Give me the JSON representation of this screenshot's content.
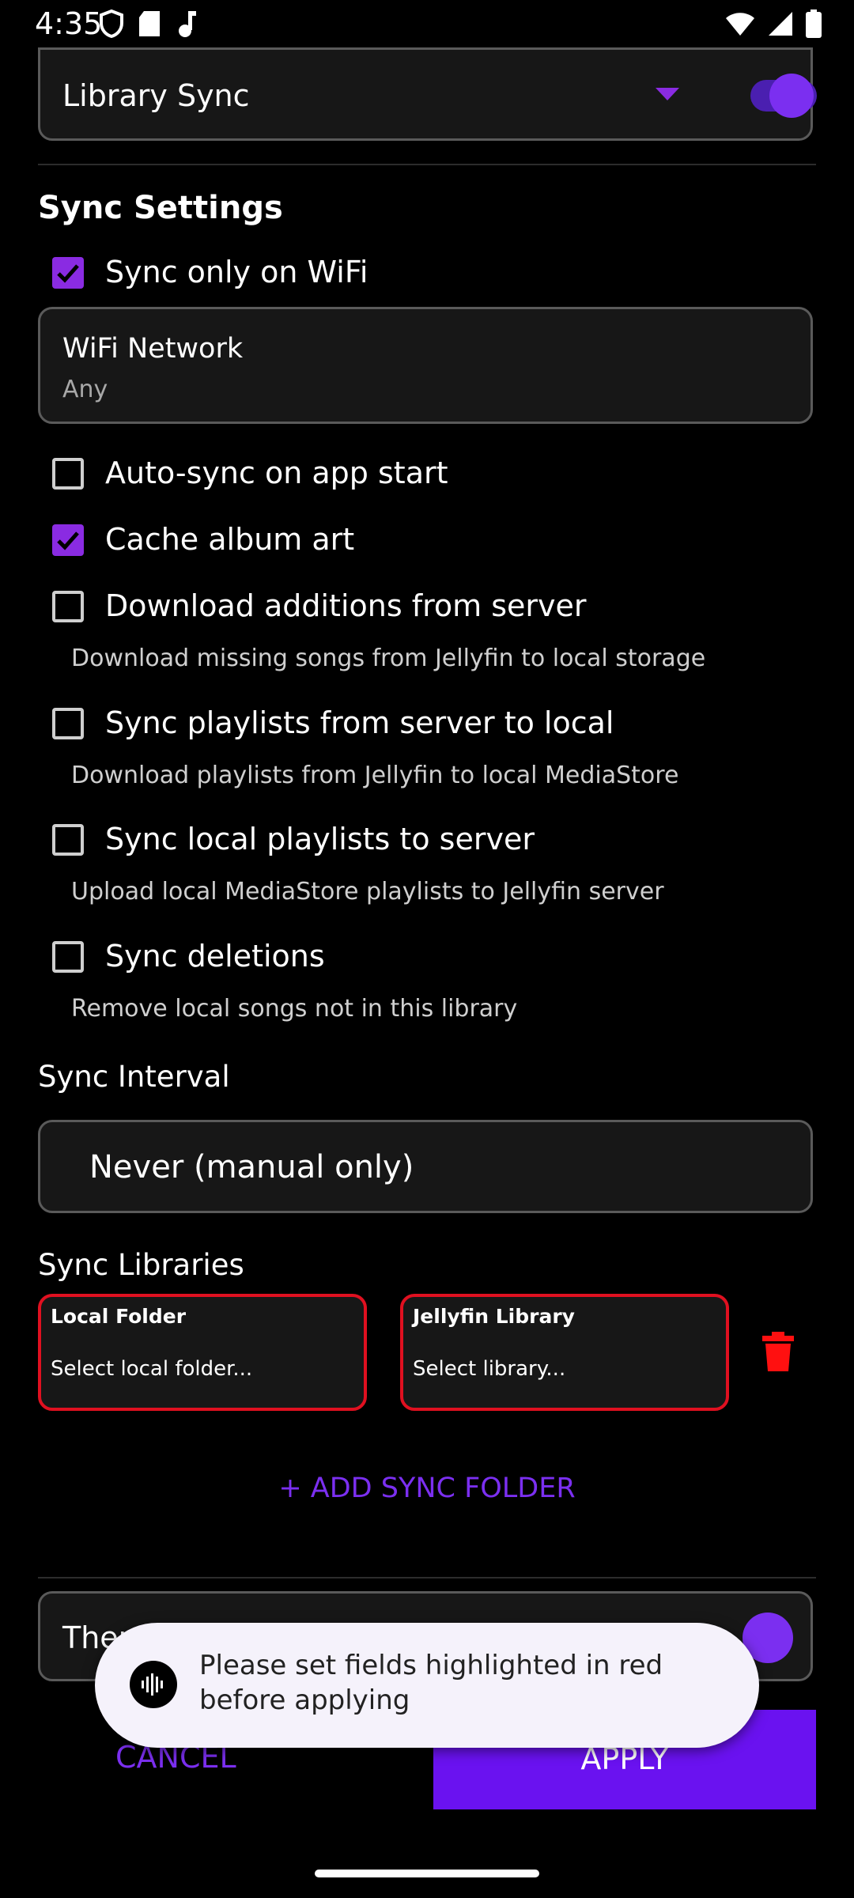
{
  "status_bar": {
    "time": "4:35"
  },
  "library_sync": {
    "label": "Library Sync",
    "enabled": true
  },
  "sync_settings": {
    "title": "Sync Settings"
  },
  "wifi_only": {
    "label": "Sync only on WiFi",
    "checked": true
  },
  "wifi_network": {
    "label": "WiFi Network",
    "value": "Any"
  },
  "options": [
    {
      "label": "Auto-sync on app start",
      "checked": false,
      "desc": ""
    },
    {
      "label": "Cache album art",
      "checked": true,
      "desc": ""
    },
    {
      "label": "Download additions from server",
      "checked": false,
      "desc": "Download missing songs from Jellyfin to local storage"
    },
    {
      "label": "Sync playlists from server to local",
      "checked": false,
      "desc": "Download playlists from Jellyfin to local MediaStore"
    },
    {
      "label": "Sync local playlists to server",
      "checked": false,
      "desc": "Upload local MediaStore playlists to Jellyfin server"
    },
    {
      "label": "Sync deletions",
      "checked": false,
      "desc": "Remove local songs not in this library"
    }
  ],
  "sync_interval": {
    "label": "Sync Interval",
    "value": "Never (manual only)"
  },
  "sync_libraries": {
    "label": "Sync Libraries",
    "local_folder": {
      "title": "Local Folder",
      "placeholder": "Select local folder..."
    },
    "jellyfin_library": {
      "title": "Jellyfin Library",
      "placeholder": "Select library..."
    }
  },
  "add_folder_label": "+ ADD SYNC FOLDER",
  "theme_row_label": "Ther",
  "toast_message": "Please set fields highlighted in red before applying",
  "buttons": {
    "cancel": "CANCEL",
    "apply": "APPLY"
  },
  "colors": {
    "accent": "#7b2ff0",
    "error": "#e01020",
    "background": "#000000"
  }
}
